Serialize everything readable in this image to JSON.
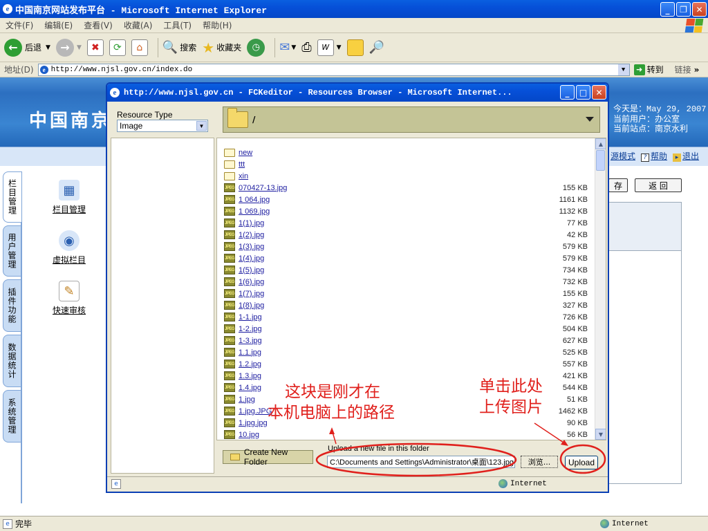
{
  "window": {
    "title": "中国南京网站发布平台 - Microsoft Internet Explorer"
  },
  "menu": [
    "文件(F)",
    "编辑(E)",
    "查看(V)",
    "收藏(A)",
    "工具(T)",
    "帮助(H)"
  ],
  "toolbar": {
    "back": "后退",
    "search": "搜索",
    "favorites": "收藏夹"
  },
  "address": {
    "label": "地址(D)",
    "url": "http://www.njsl.gov.cn/index.do",
    "go": "转到",
    "links": "链接"
  },
  "page": {
    "logo": "中国南京",
    "info": {
      "today_label": "今天是：",
      "today_value": "May 29, 2007",
      "user": "当前用户：办公室",
      "site": "当前站点：南京水利"
    },
    "mode_links": [
      "源模式",
      "帮助",
      "退出"
    ],
    "side_tabs": [
      "栏目管理",
      "用户管理",
      "插件功能",
      "数据统计",
      "系统管理"
    ],
    "nav": [
      "栏目管理",
      "虚拟栏目",
      "快速审核"
    ],
    "buttons": {
      "save_partial": "存",
      "back": "返 回"
    }
  },
  "dialog": {
    "title": "http://www.njsl.gov.cn - FCKeditor - Resources Browser - Microsoft Internet...",
    "resource_type_label": "Resource Type",
    "resource_type_value": "Image",
    "current_path": "/",
    "files": [
      {
        "name": "new",
        "type": "folder",
        "size": ""
      },
      {
        "name": "ttt",
        "type": "folder",
        "size": ""
      },
      {
        "name": "xin",
        "type": "folder",
        "size": ""
      },
      {
        "name": "070427-13.jpg",
        "type": "image",
        "size": "155 KB"
      },
      {
        "name": "1 064.jpg",
        "type": "image",
        "size": "1161 KB"
      },
      {
        "name": "1 069.jpg",
        "type": "image",
        "size": "1132 KB"
      },
      {
        "name": "1(1).jpg",
        "type": "image",
        "size": "77 KB"
      },
      {
        "name": "1(2).jpg",
        "type": "image",
        "size": "42 KB"
      },
      {
        "name": "1(3).jpg",
        "type": "image",
        "size": "579 KB"
      },
      {
        "name": "1(4).jpg",
        "type": "image",
        "size": "579 KB"
      },
      {
        "name": "1(5).jpg",
        "type": "image",
        "size": "734 KB"
      },
      {
        "name": "1(6).jpg",
        "type": "image",
        "size": "732 KB"
      },
      {
        "name": "1(7).jpg",
        "type": "image",
        "size": "155 KB"
      },
      {
        "name": "1(8).jpg",
        "type": "image",
        "size": "327 KB"
      },
      {
        "name": "1-1.jpg",
        "type": "image",
        "size": "726 KB"
      },
      {
        "name": "1-2.jpg",
        "type": "image",
        "size": "504 KB"
      },
      {
        "name": "1-3.jpg",
        "type": "image",
        "size": "627 KB"
      },
      {
        "name": "1.1.jpg",
        "type": "image",
        "size": "525 KB"
      },
      {
        "name": "1.2.jpg",
        "type": "image",
        "size": "557 KB"
      },
      {
        "name": "1.3.jpg",
        "type": "image",
        "size": "421 KB"
      },
      {
        "name": "1.4.jpg",
        "type": "image",
        "size": "544 KB"
      },
      {
        "name": "1.jpg",
        "type": "image",
        "size": "51 KB"
      },
      {
        "name": "1.jpg.JPG",
        "type": "image",
        "size": "1462 KB"
      },
      {
        "name": "1.jpg.jpg",
        "type": "image",
        "size": "90 KB"
      },
      {
        "name": "10.jpg",
        "type": "image",
        "size": "56 KB"
      }
    ],
    "create_folder": "Create New Folder",
    "upload_label": "Upload a new file in this folder",
    "upload_value": "C:\\Documents and Settings\\Administrator\\桌面\\123.jpg",
    "browse": "浏览...",
    "upload": "Upload",
    "status_zone": "Internet"
  },
  "annotations": {
    "left": [
      "这块是刚才在",
      "本机电脑上的路径"
    ],
    "right": [
      "单击此处",
      "上传图片"
    ],
    "color": "#e0201c"
  },
  "status": {
    "done": "完毕",
    "zone": "Internet"
  }
}
